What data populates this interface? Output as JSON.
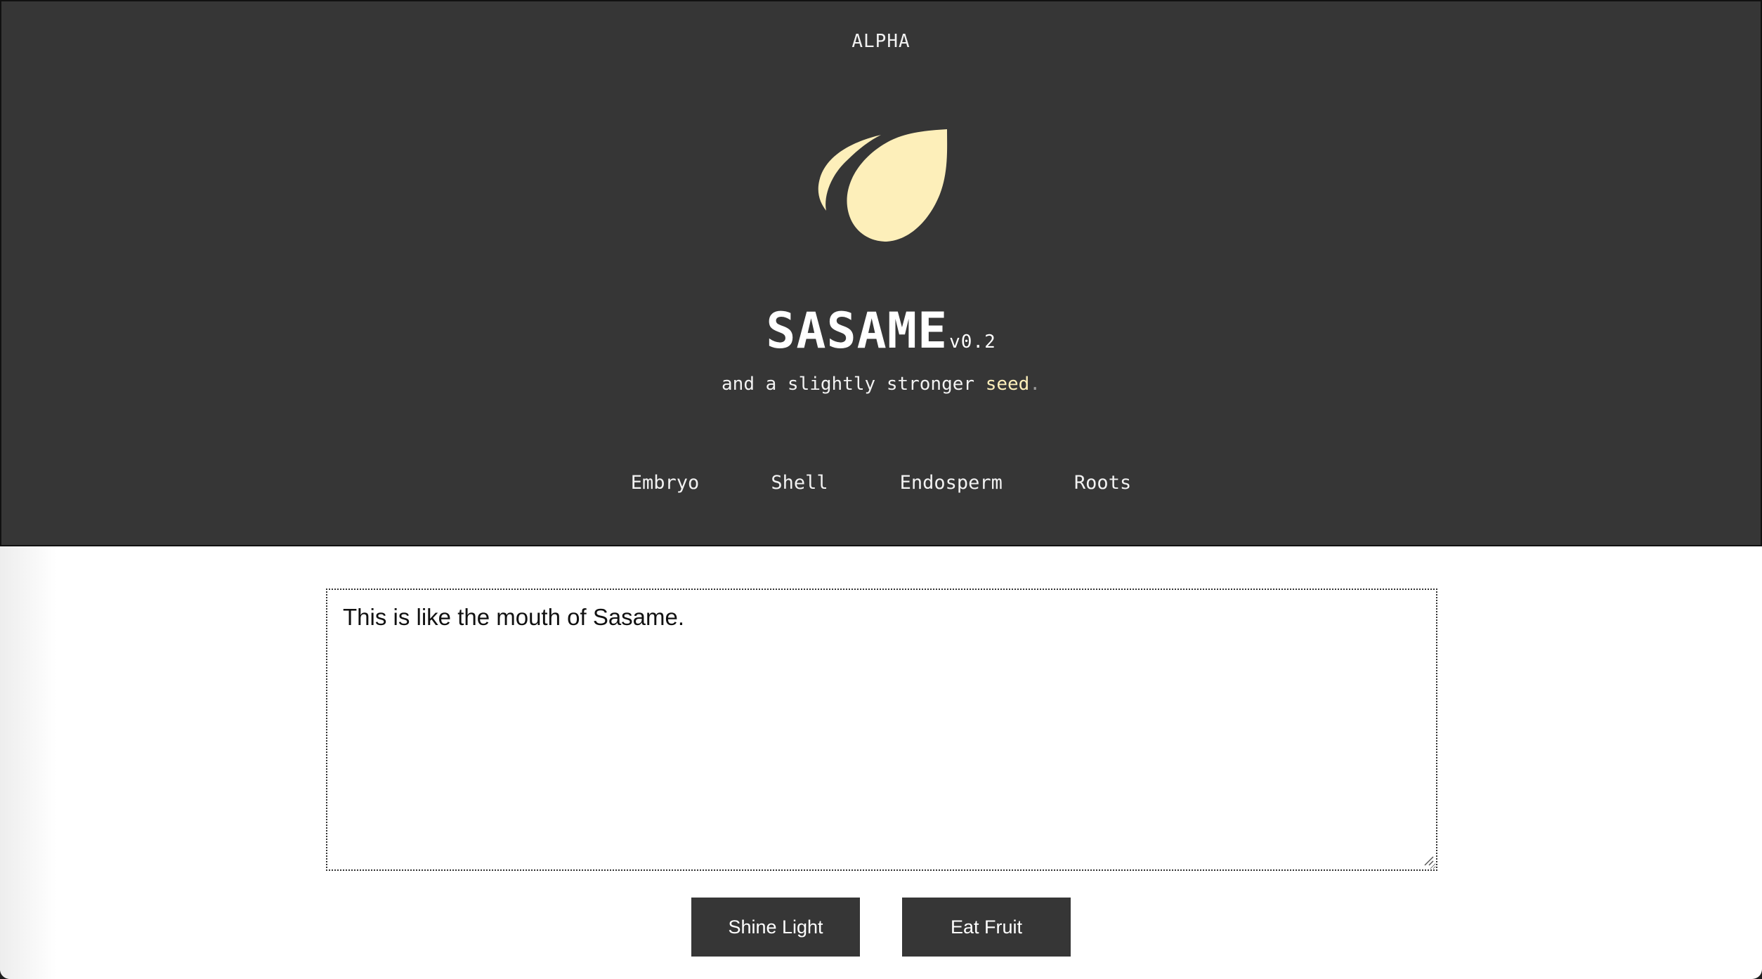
{
  "header": {
    "badge": "ALPHA",
    "title": "SASAME",
    "version": "v0.2",
    "tagline_prefix": "and a slightly stronger ",
    "tagline_accent": "seed",
    "tagline_suffix": ".",
    "logo_icon": "seed-icon"
  },
  "nav": {
    "items": [
      {
        "label": "Embryo"
      },
      {
        "label": "Shell"
      },
      {
        "label": "Endosperm"
      },
      {
        "label": "Roots"
      }
    ]
  },
  "editor": {
    "value": "This is like the mouth of Sasame."
  },
  "actions": {
    "shine_label": "Shine Light",
    "eat_label": "Eat Fruit"
  },
  "colors": {
    "header_bg": "#363636",
    "accent": "#fdefba",
    "button_bg": "#363636"
  }
}
